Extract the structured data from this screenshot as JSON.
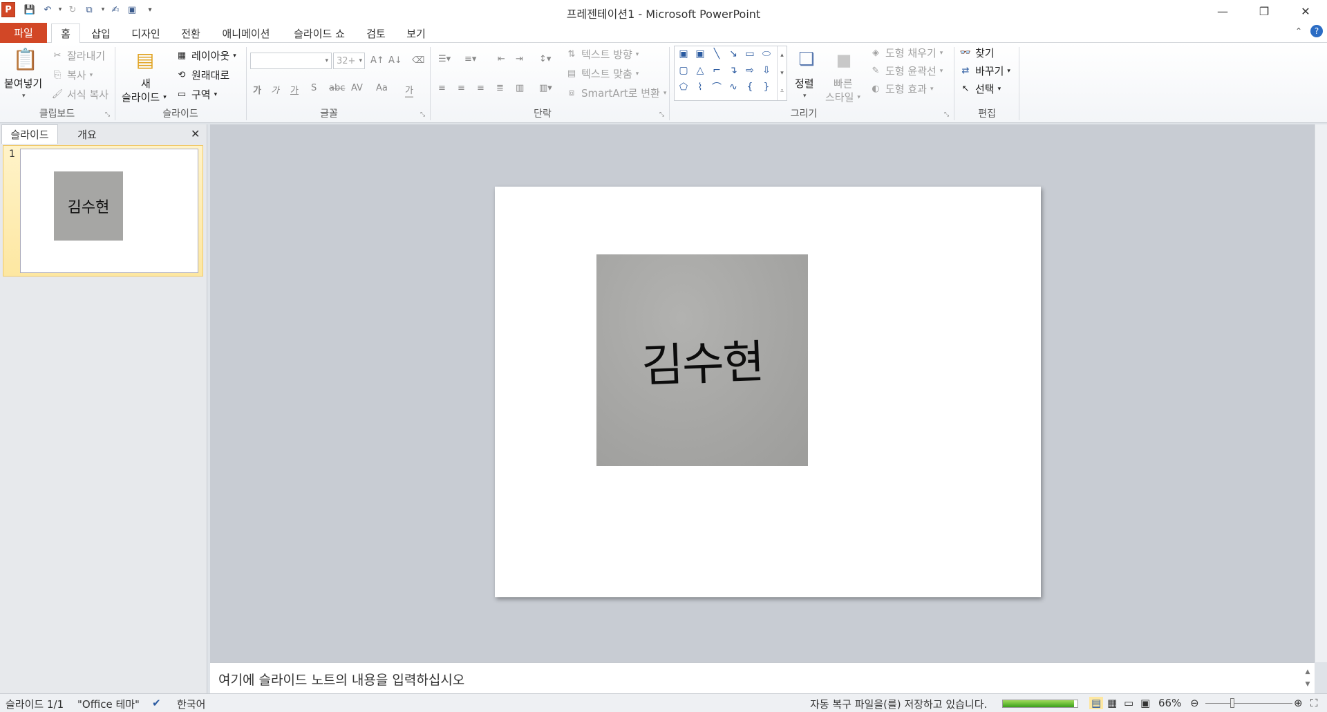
{
  "window": {
    "app_title": "프레젠테이션1  -  Microsoft PowerPoint",
    "app_logo": "P",
    "minimize": "—",
    "restore": "❐",
    "close": "✕"
  },
  "quick_access": {
    "icons": [
      "save-icon",
      "undo-icon",
      "redo-icon",
      "repeat-icon",
      "touch-icon",
      "slideshow-icon",
      "customize-icon"
    ]
  },
  "tabs": {
    "file": "파일",
    "items": [
      "홈",
      "삽입",
      "디자인",
      "전환",
      "애니메이션",
      "슬라이드 쇼",
      "검토",
      "보기"
    ],
    "active": "홈"
  },
  "ribbon": {
    "clipboard": {
      "label": "클립보드",
      "paste": "붙여넣기",
      "cut": "잘라내기",
      "copy": "복사",
      "format_painter": "서식 복사"
    },
    "slides": {
      "label": "슬라이드",
      "new_slide_line1": "새",
      "new_slide_line2": "슬라이드",
      "layout": "레이아웃",
      "reset": "원래대로",
      "section": "구역"
    },
    "font": {
      "label": "글꼴",
      "font_name": "",
      "font_size": "32+"
    },
    "paragraph": {
      "label": "단락",
      "text_direction": "텍스트 방향",
      "align_text": "텍스트 맞춤",
      "smartart": "SmartArt로 변환"
    },
    "drawing": {
      "label": "그리기",
      "arrange": "정렬",
      "quick_styles_line1": "빠른",
      "quick_styles_line2": "스타일",
      "shape_fill": "도형 채우기",
      "shape_outline": "도형 윤곽선",
      "shape_effects": "도형 효과"
    },
    "editing": {
      "label": "편집",
      "find": "찾기",
      "replace": "바꾸기",
      "select": "선택"
    }
  },
  "left_panel": {
    "tab_slides": "슬라이드",
    "tab_outline": "개요",
    "close": "✕",
    "slide_number": "1",
    "thumb_text": "김수현"
  },
  "slide": {
    "image_text": "김수현"
  },
  "notes": {
    "placeholder": "여기에 슬라이드 노트의 내용을 입력하십시오"
  },
  "status_bar": {
    "slide_pos": "슬라이드 1/1",
    "theme": "\"Office 테마\"",
    "language": "한국어",
    "autosave": "자동 복구 파일을(를) 저장하고 있습니다.",
    "autosave_progress": 0.95,
    "zoom": "66%"
  }
}
